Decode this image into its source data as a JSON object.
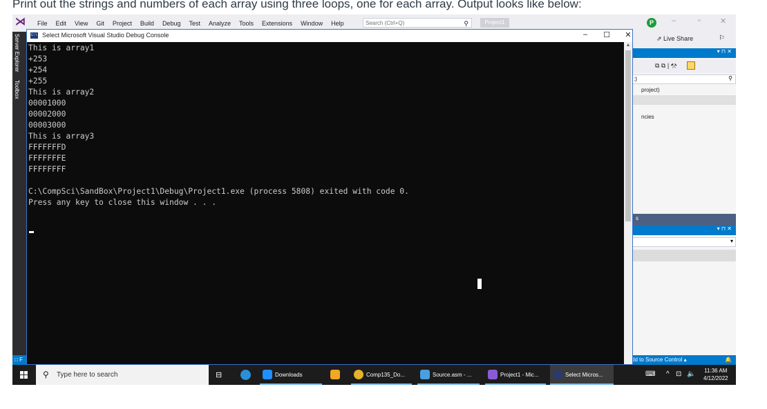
{
  "caption": "Print out the strings and numbers of each array using three loops, one for each array. Output looks like below:",
  "vs": {
    "menu": [
      "File",
      "Edit",
      "View",
      "Git",
      "Project",
      "Build",
      "Debug",
      "Test",
      "Analyze",
      "Tools",
      "Extensions",
      "Window",
      "Help"
    ],
    "search_placeholder": "Search (Ctrl+Q)",
    "project_title": "Project1",
    "avatar_initial": "P",
    "live_share": "Live Share",
    "left_tabs": [
      "Server Explorer",
      "Toolbox"
    ],
    "solution_fragments": [
      ":)",
      "project)",
      "ncies"
    ],
    "blue_fragment": "s",
    "source_control": "dd to Source Control",
    "status_left": "F"
  },
  "console": {
    "window_title": "Select Microsoft Visual Studio Debug Console",
    "icon_text": "C:\\",
    "lines": [
      "This is array1",
      "+253",
      "+254",
      "+255",
      "This is array2",
      "00001000",
      "00002000",
      "00003000",
      "This is array3",
      "FFFFFFFD",
      "FFFFFFFE",
      "FFFFFFFF",
      "",
      "C:\\CompSci\\SandBox\\Project1\\Debug\\Project1.exe (process 5808) exited with code 0.",
      "Press any key to close this window . . ."
    ]
  },
  "taskbar": {
    "search_placeholder": "Type here to search",
    "apps": [
      {
        "label": "Downloads",
        "icon": "download-icon",
        "color": "#1e90ff"
      },
      {
        "label": "",
        "icon": "store-icon",
        "color": "#f5a623"
      },
      {
        "label": "Comp135_Do...",
        "icon": "chrome-icon",
        "color": "#e5b22b"
      },
      {
        "label": "Source.asm - ...",
        "icon": "notepad-icon",
        "color": "#4a9fe0"
      },
      {
        "label": "Project1 - Mic...",
        "icon": "visual-studio-icon",
        "color": "#8a5bd6"
      },
      {
        "label": "Select Micros...",
        "icon": "console-icon",
        "color": "#2b3a67"
      }
    ],
    "time": "11:36 AM",
    "date": "4/12/2022"
  }
}
